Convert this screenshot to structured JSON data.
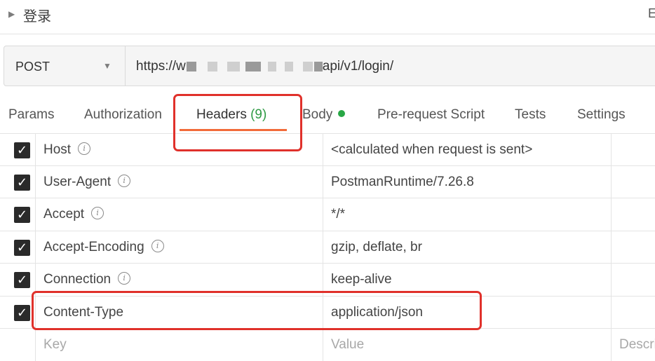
{
  "request": {
    "name": "登录",
    "right_label": "E"
  },
  "url_bar": {
    "method": "POST",
    "url_prefix": "https://w",
    "url_suffix": "api/v1/login/"
  },
  "tabs": [
    {
      "label": "Params"
    },
    {
      "label": "Authorization"
    },
    {
      "label": "Headers",
      "count": "(9)",
      "active": true
    },
    {
      "label": "Body"
    },
    {
      "label": "Pre-request Script"
    },
    {
      "label": "Tests"
    },
    {
      "label": "Settings"
    }
  ],
  "headers": [
    {
      "key": "Host",
      "value": "<calculated when request is sent>",
      "checked": true,
      "info": true
    },
    {
      "key": "User-Agent",
      "value": "PostmanRuntime/7.26.8",
      "checked": true,
      "info": true
    },
    {
      "key": "Accept",
      "value": "*/*",
      "checked": true,
      "info": true
    },
    {
      "key": "Accept-Encoding",
      "value": "gzip, deflate, br",
      "checked": true,
      "info": true
    },
    {
      "key": "Connection",
      "value": "keep-alive",
      "checked": true,
      "info": true
    },
    {
      "key": "Content-Type",
      "value": "application/json",
      "checked": true,
      "info": false
    }
  ],
  "new_row": {
    "key_placeholder": "Key",
    "value_placeholder": "Value",
    "desc_placeholder": "Descri"
  },
  "colors": {
    "accent_underline": "#f26b3a",
    "count_green": "#2e9a44",
    "highlight_red": "#e0312b",
    "body_dot": "#28a745"
  },
  "icons": {
    "check": "check-icon",
    "info": "info-icon",
    "caret": "caret-right-icon",
    "dropdown": "chevron-down-icon"
  }
}
